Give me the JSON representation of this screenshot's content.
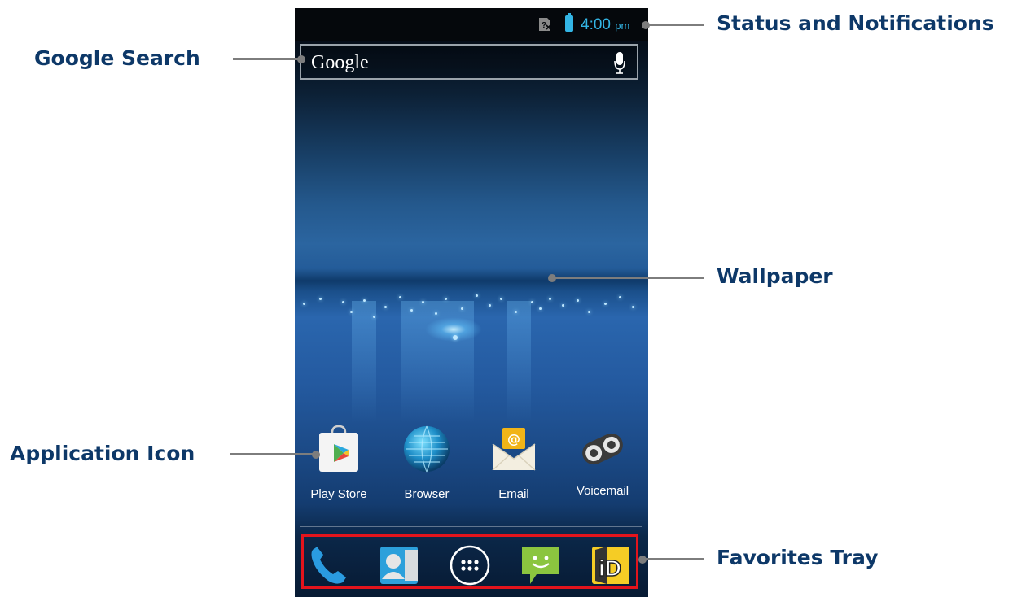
{
  "status_bar": {
    "time": "4:00",
    "ampm": "pm",
    "battery_color": "#33b5e5",
    "icons": [
      "no-sim-icon",
      "battery-icon"
    ]
  },
  "search_bar": {
    "logo_text": "Google",
    "icons": [
      "mic-icon"
    ]
  },
  "apps": [
    {
      "label": "Play Store",
      "icon": "play-store-icon"
    },
    {
      "label": "Browser",
      "icon": "browser-icon"
    },
    {
      "label": "Email",
      "icon": "email-icon"
    },
    {
      "label": "Voicemail",
      "icon": "voicemail-icon"
    }
  ],
  "favorites_tray": {
    "items": [
      "phone-icon",
      "contacts-icon",
      "app-drawer-icon",
      "messaging-icon",
      "id-app-icon"
    ],
    "highlight_color": "#e3141c"
  },
  "callouts": {
    "status": "Status and Notifications",
    "google_search": "Google Search",
    "wallpaper": "Wallpaper",
    "application_icon": "Application Icon",
    "favorites_tray": "Favorites Tray",
    "text_color": "#0d3868"
  }
}
